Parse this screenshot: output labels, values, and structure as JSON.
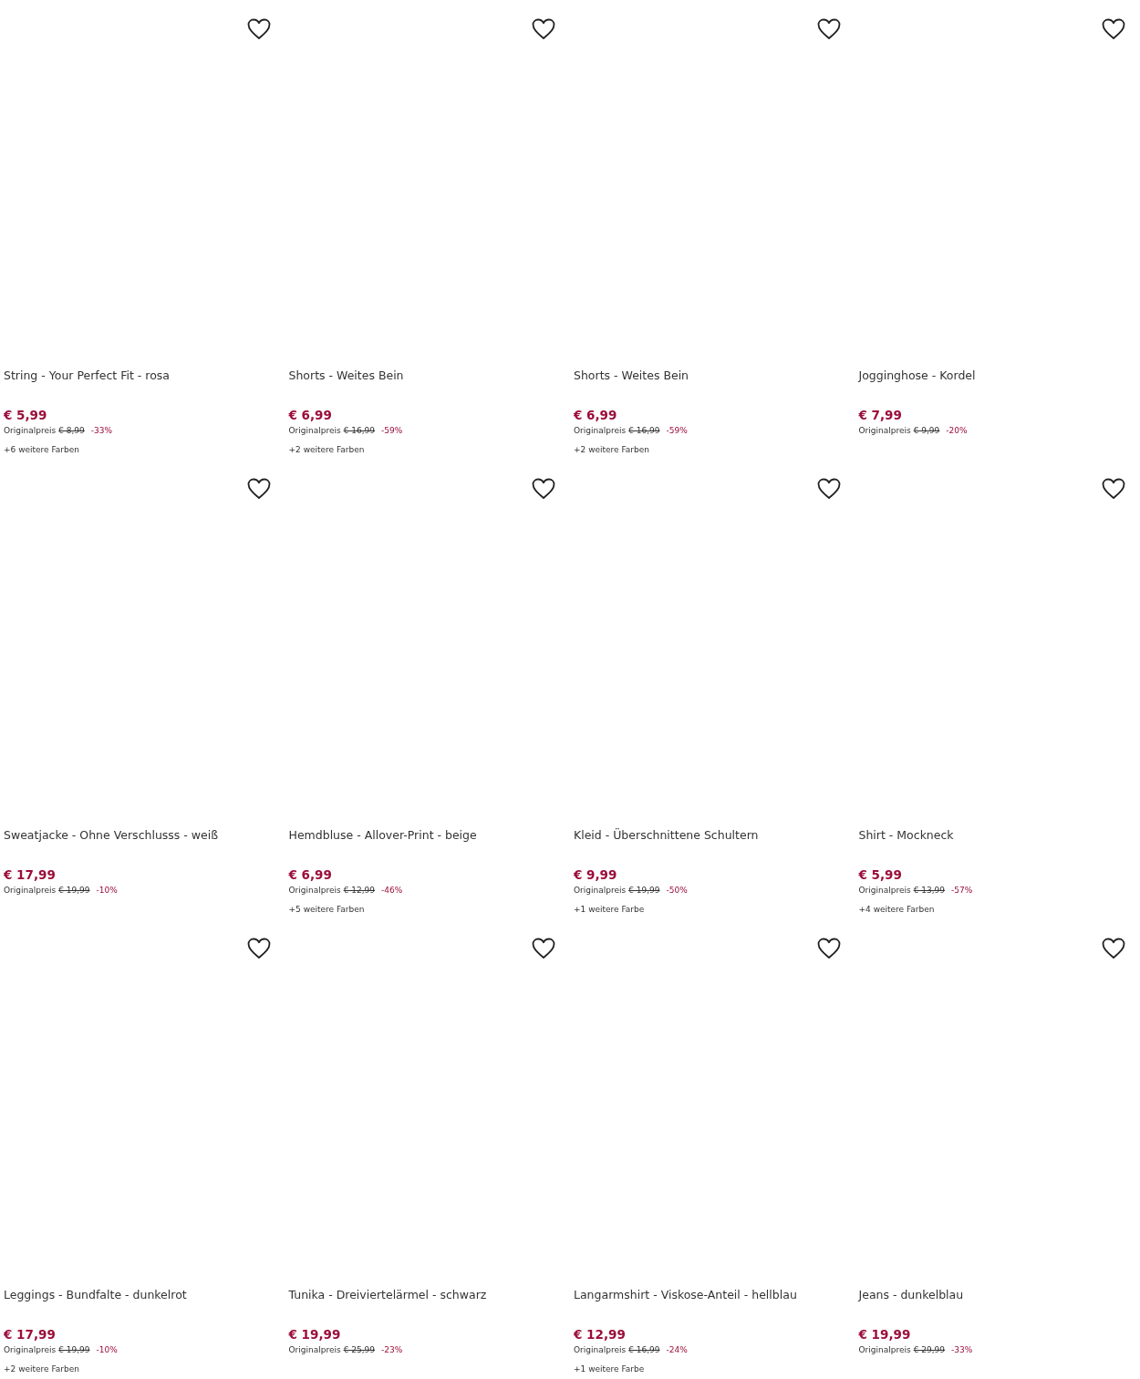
{
  "products": [
    {
      "name": "String - Your Perfect Fit - rosa",
      "price": "€ 5,99",
      "original_label": "Originalpreis",
      "original_price": "€ 8,99",
      "discount": "-33%",
      "colors": "+6 weitere Farben",
      "saved": false
    },
    {
      "name": "Shorts - Weites Bein",
      "price": "€ 6,99",
      "original_label": "Originalpreis",
      "original_price": "€ 16,99",
      "discount": "-59%",
      "colors": "+2 weitere Farben",
      "saved": false
    },
    {
      "name": "Shorts - Weites Bein",
      "price": "€ 6,99",
      "original_label": "Originalpreis",
      "original_price": "€ 16,99",
      "discount": "-59%",
      "colors": "+2 weitere Farben",
      "saved": false
    },
    {
      "name": "Jogginghose - Kordel",
      "price": "€ 7,99",
      "original_label": "Originalpreis",
      "original_price": "€ 9,99",
      "discount": "-20%",
      "saved": false
    },
    {
      "name": "Sweatjacke - Ohne Verschlusss - weiß",
      "price": "€ 17,99",
      "original_label": "Originalpreis",
      "original_price": "€ 19,99",
      "discount": "-10%",
      "saved": false
    },
    {
      "name": "Hemdbluse - Allover-Print - beige",
      "price": "€ 6,99",
      "original_label": "Originalpreis",
      "original_price": "€ 12,99",
      "discount": "-46%",
      "colors": "+5 weitere Farben",
      "saved": false
    },
    {
      "name": "Kleid - Überschnittene Schultern",
      "price": "€ 9,99",
      "original_label": "Originalpreis",
      "original_price": "€ 19,99",
      "discount": "-50%",
      "colors": "+1 weitere Farbe",
      "saved": false
    },
    {
      "name": "Shirt - Mockneck",
      "price": "€ 5,99",
      "original_label": "Originalpreis",
      "original_price": "€ 13,99",
      "discount": "-57%",
      "colors": "+4 weitere Farben",
      "saved": false
    },
    {
      "name": "Leggings - Bundfalte - dunkelrot",
      "price": "€ 17,99",
      "original_label": "Originalpreis",
      "original_price": "€ 19,99",
      "discount": "-10%",
      "colors": "+2 weitere Farben",
      "saved": false
    },
    {
      "name": "Tunika - Dreiviertelärmel - schwarz",
      "price": "€ 19,99",
      "original_label": "Originalpreis",
      "original_price": "€ 25,99",
      "discount": "-23%",
      "saved": false
    },
    {
      "name": "Langarmshirt - Viskose-Anteil - hellblau",
      "price": "€ 12,99",
      "original_label": "Originalpreis",
      "original_price": "€ 16,99",
      "discount": "-24%",
      "colors": "+1 weitere Farbe",
      "saved": false
    },
    {
      "name": "Jeans - dunkelblau",
      "price": "€ 19,99",
      "original_label": "Originalpreis",
      "original_price": "€ 29,99",
      "discount": "-33%",
      "saved": false
    }
  ]
}
